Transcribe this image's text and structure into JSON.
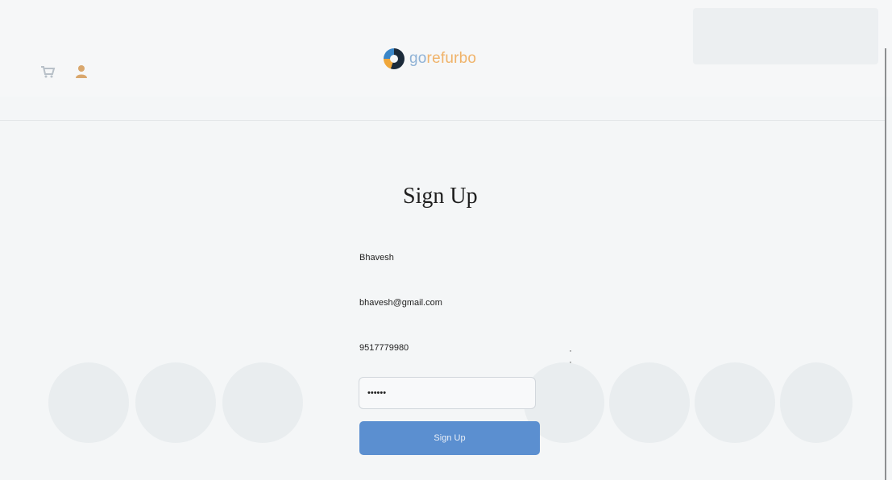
{
  "header": {
    "logo_prefix": "go",
    "logo_suffix": "refurbo",
    "auth_link": "",
    "icons": {
      "cart": "cart-icon",
      "user": "user-icon"
    }
  },
  "nav": {
    "items": [
      {
        "label": ""
      },
      {
        "label": ""
      },
      {
        "label": ""
      },
      {
        "label": ""
      },
      {
        "label": ""
      },
      {
        "label": ""
      }
    ]
  },
  "form": {
    "title": "Sign Up",
    "subtitle": "",
    "name_value": "Bhavesh",
    "email_value": "bhavesh@gmail.com",
    "phone_value": "9517779980",
    "password_mask": "••••••",
    "submit_label": "Sign Up",
    "login_prompt": ""
  },
  "colors": {
    "accent": "#5b8fd0",
    "logo_blue": "#8fb2d6",
    "logo_orange": "#f0b36a",
    "nav_text": "#c9a481",
    "background": "#f4f6f7"
  }
}
